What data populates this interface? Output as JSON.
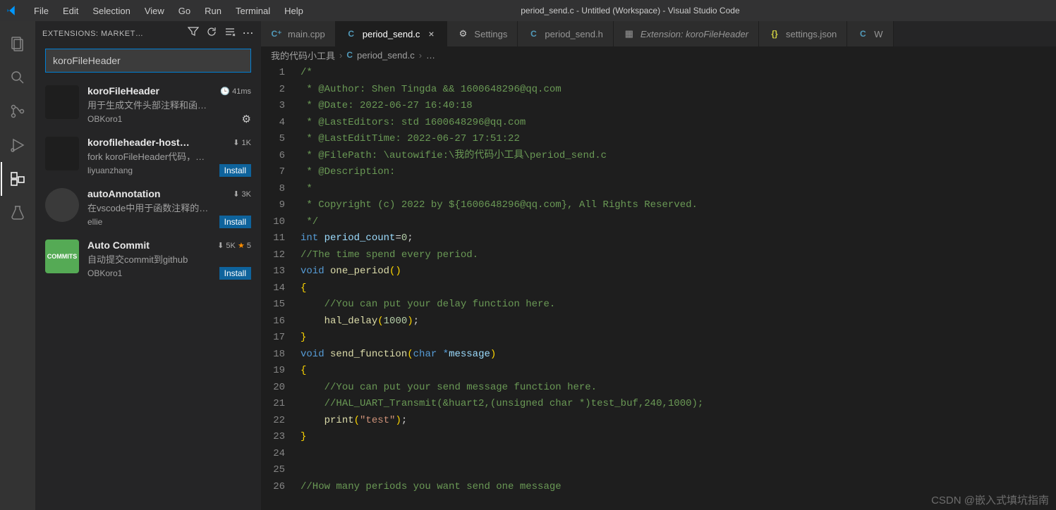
{
  "titlebar": {
    "title": "period_send.c - Untitled (Workspace) - Visual Studio Code",
    "menu": [
      "File",
      "Edit",
      "Selection",
      "View",
      "Go",
      "Run",
      "Terminal",
      "Help"
    ]
  },
  "activitybar": {
    "items": [
      {
        "name": "explorer",
        "label": "Explorer"
      },
      {
        "name": "search",
        "label": "Search"
      },
      {
        "name": "scm",
        "label": "Source Control"
      },
      {
        "name": "debug",
        "label": "Run and Debug"
      },
      {
        "name": "extensions",
        "label": "Extensions"
      },
      {
        "name": "testing",
        "label": "Testing"
      }
    ],
    "activeIndex": 4
  },
  "sidebar": {
    "header": "EXTENSIONS: MARKET…",
    "searchValue": "koroFileHeader",
    "extensions": [
      {
        "name": "koroFileHeader",
        "meta": "🕒 41ms",
        "desc": "用于生成文件头部注释和函…",
        "author": "OBKoro1",
        "action": "gear",
        "iconKind": "text"
      },
      {
        "name": "korofileheader-host…",
        "meta": "⬇ 1K",
        "desc": "fork koroFileHeader代码，…",
        "author": "liyuanzhang",
        "action": "install",
        "actionLabel": "Install",
        "iconKind": "text"
      },
      {
        "name": "autoAnnotation",
        "meta": "⬇ 3K",
        "desc": "在vscode中用于函数注释的…",
        "author": "ellie",
        "action": "install",
        "actionLabel": "Install",
        "iconKind": "round"
      },
      {
        "name": "Auto Commit",
        "meta": "⬇ 5K ★ 5",
        "desc": "自动提交commit到github",
        "author": "OBKoro1",
        "action": "install",
        "actionLabel": "Install",
        "iconKind": "commits",
        "iconText": "COMMITS"
      }
    ]
  },
  "tabs": [
    {
      "icon": "cplus",
      "label": "main.cpp",
      "active": false
    },
    {
      "icon": "c",
      "label": "period_send.c",
      "active": true,
      "close": true
    },
    {
      "icon": "gear",
      "label": "Settings",
      "active": false
    },
    {
      "icon": "c",
      "label": "period_send.h",
      "active": false
    },
    {
      "icon": "none",
      "label": "Extension: koroFileHeader",
      "active": false,
      "italic": true
    },
    {
      "icon": "brackets",
      "label": "settings.json",
      "active": false
    },
    {
      "icon": "c",
      "label": "W",
      "active": false,
      "cut": true
    }
  ],
  "breadcrumb": {
    "crumbs": [
      "我的代码小工具",
      "period_send.c",
      "…"
    ],
    "crumbIcon1": "C"
  },
  "code": {
    "lines": [
      {
        "n": 1,
        "tokens": [
          {
            "c": "comment",
            "t": "/*"
          }
        ]
      },
      {
        "n": 2,
        "tokens": [
          {
            "c": "comment",
            "t": " * @Author: Shen Tingda && 1600648296@qq.com"
          }
        ]
      },
      {
        "n": 3,
        "tokens": [
          {
            "c": "comment",
            "t": " * @Date: 2022-06-27 16:40:18"
          }
        ]
      },
      {
        "n": 4,
        "tokens": [
          {
            "c": "comment",
            "t": " * @LastEditors: std 1600648296@qq.com"
          }
        ]
      },
      {
        "n": 5,
        "tokens": [
          {
            "c": "comment",
            "t": " * @LastEditTime: 2022-06-27 17:51:22"
          }
        ]
      },
      {
        "n": 6,
        "tokens": [
          {
            "c": "comment",
            "t": " * @FilePath: \\autowifie:\\我的代码小工具\\period_send.c"
          }
        ]
      },
      {
        "n": 7,
        "tokens": [
          {
            "c": "comment",
            "t": " * @Description: "
          }
        ]
      },
      {
        "n": 8,
        "tokens": [
          {
            "c": "comment",
            "t": " * "
          }
        ]
      },
      {
        "n": 9,
        "tokens": [
          {
            "c": "comment",
            "t": " * Copyright (c) 2022 by ${1600648296@qq.com}, All Rights Reserved. "
          }
        ]
      },
      {
        "n": 10,
        "tokens": [
          {
            "c": "comment",
            "t": " */"
          }
        ]
      },
      {
        "n": 11,
        "tokens": [
          {
            "c": "type",
            "t": "int"
          },
          {
            "c": "plain",
            "t": " "
          },
          {
            "c": "ident",
            "t": "period_count"
          },
          {
            "c": "operator",
            "t": "="
          },
          {
            "c": "number",
            "t": "0"
          },
          {
            "c": "punc",
            "t": ";"
          }
        ]
      },
      {
        "n": 12,
        "tokens": [
          {
            "c": "comment",
            "t": "//The time spend every period."
          }
        ]
      },
      {
        "n": 13,
        "tokens": [
          {
            "c": "type",
            "t": "void"
          },
          {
            "c": "plain",
            "t": " "
          },
          {
            "c": "func",
            "t": "one_period"
          },
          {
            "c": "brace",
            "t": "()"
          }
        ]
      },
      {
        "n": 14,
        "tokens": [
          {
            "c": "brace",
            "t": "{"
          }
        ]
      },
      {
        "n": 15,
        "tokens": [
          {
            "c": "plain",
            "t": "    "
          },
          {
            "c": "comment",
            "t": "//You can put your delay function here."
          }
        ]
      },
      {
        "n": 16,
        "tokens": [
          {
            "c": "plain",
            "t": "    "
          },
          {
            "c": "func",
            "t": "hal_delay"
          },
          {
            "c": "brace",
            "t": "("
          },
          {
            "c": "number",
            "t": "1000"
          },
          {
            "c": "brace",
            "t": ")"
          },
          {
            "c": "punc",
            "t": ";"
          }
        ]
      },
      {
        "n": 17,
        "tokens": [
          {
            "c": "brace",
            "t": "}"
          }
        ]
      },
      {
        "n": 18,
        "tokens": [
          {
            "c": "type",
            "t": "void"
          },
          {
            "c": "plain",
            "t": " "
          },
          {
            "c": "func",
            "t": "send_function"
          },
          {
            "c": "brace",
            "t": "("
          },
          {
            "c": "type",
            "t": "char"
          },
          {
            "c": "plain",
            "t": " "
          },
          {
            "c": "deref",
            "t": "*"
          },
          {
            "c": "param",
            "t": "message"
          },
          {
            "c": "brace",
            "t": ")"
          }
        ]
      },
      {
        "n": 19,
        "tokens": [
          {
            "c": "brace",
            "t": "{"
          }
        ]
      },
      {
        "n": 20,
        "tokens": [
          {
            "c": "plain",
            "t": "    "
          },
          {
            "c": "comment",
            "t": "//You can put your send message function here."
          }
        ]
      },
      {
        "n": 21,
        "tokens": [
          {
            "c": "plain",
            "t": "    "
          },
          {
            "c": "comment",
            "t": "//HAL_UART_Transmit(&huart2,(unsigned char *)test_buf,240,1000);"
          }
        ]
      },
      {
        "n": 22,
        "tokens": [
          {
            "c": "plain",
            "t": "    "
          },
          {
            "c": "func",
            "t": "print"
          },
          {
            "c": "brace",
            "t": "("
          },
          {
            "c": "string",
            "t": "\"test\""
          },
          {
            "c": "brace",
            "t": ")"
          },
          {
            "c": "punc",
            "t": ";"
          }
        ]
      },
      {
        "n": 23,
        "tokens": [
          {
            "c": "brace",
            "t": "}"
          }
        ]
      },
      {
        "n": 24,
        "tokens": [
          {
            "c": "plain",
            "t": ""
          }
        ]
      },
      {
        "n": 25,
        "tokens": [
          {
            "c": "plain",
            "t": ""
          }
        ]
      },
      {
        "n": 26,
        "tokens": [
          {
            "c": "comment",
            "t": "//How many periods you want send one message"
          }
        ]
      }
    ]
  },
  "watermark": "CSDN @嵌入式填坑指南"
}
